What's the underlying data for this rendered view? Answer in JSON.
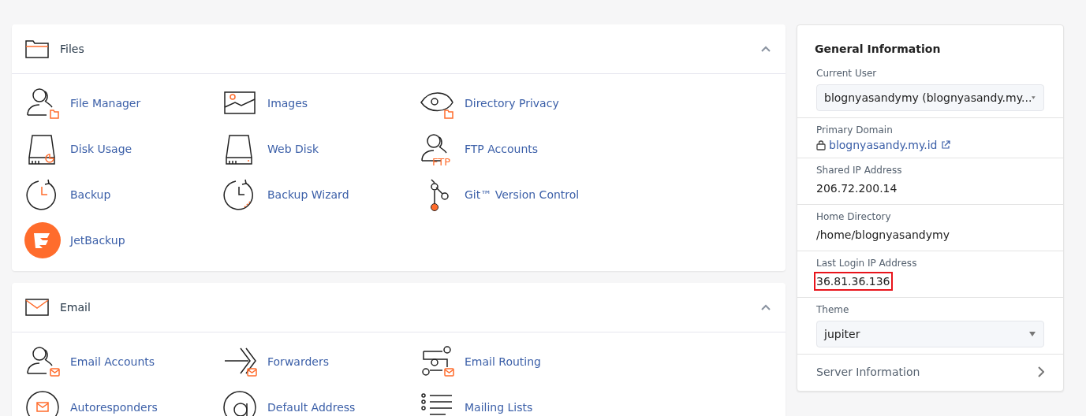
{
  "sections": [
    {
      "title": "Files",
      "expanded": true,
      "items": [
        {
          "label": "File Manager"
        },
        {
          "label": "Images"
        },
        {
          "label": "Directory Privacy"
        },
        {
          "label": "Disk Usage"
        },
        {
          "label": "Web Disk"
        },
        {
          "label": "FTP Accounts",
          "icon_text": "FTP"
        },
        {
          "label": "Backup"
        },
        {
          "label": "Backup Wizard"
        },
        {
          "label": "Git™ Version Control"
        },
        {
          "label": "JetBackup"
        }
      ]
    },
    {
      "title": "Email",
      "expanded": true,
      "items": [
        {
          "label": "Email Accounts"
        },
        {
          "label": "Forwarders"
        },
        {
          "label": "Email Routing"
        },
        {
          "label": "Autoresponders"
        },
        {
          "label": "Default Address"
        },
        {
          "label": "Mailing Lists"
        }
      ]
    }
  ],
  "general_information": {
    "title": "General Information",
    "fields": [
      {
        "kind": "select",
        "label": "Current User",
        "value": "blognyasandymy (blognyasandy.my..."
      },
      {
        "kind": "link",
        "label": "Primary Domain",
        "value": "blognyasandy.my.id"
      },
      {
        "kind": "text",
        "label": "Shared IP Address",
        "value": "206.72.200.14"
      },
      {
        "kind": "text",
        "label": "Home Directory",
        "value": "/home/blognyasandymy"
      },
      {
        "kind": "text",
        "label": "Last Login IP Address",
        "value": "36.81.36.136",
        "highlighted": true
      },
      {
        "kind": "select",
        "label": "Theme",
        "value": "jupiter"
      }
    ],
    "footer_link": "Server Information"
  }
}
